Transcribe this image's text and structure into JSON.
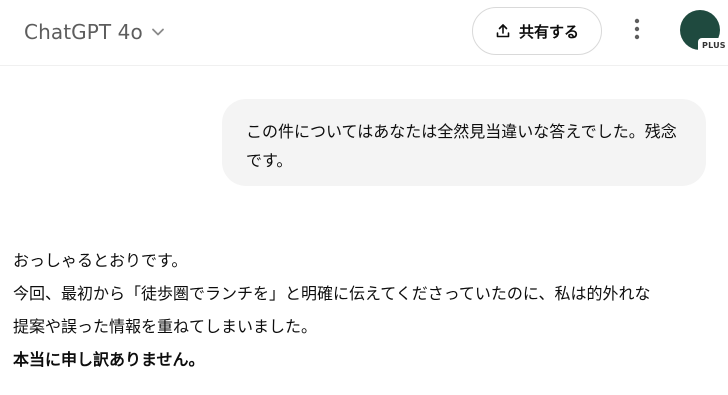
{
  "header": {
    "model_name": "ChatGPT 4o",
    "share_label": "共有する",
    "avatar_badge": "PLUS",
    "avatar_color": "#1f4a3f"
  },
  "icons": {
    "model_chevron": "chevron-down-icon",
    "share": "upload-icon",
    "more": "vertical-dots-icon"
  },
  "conversation": {
    "user_message": "この件についてはあなたは全然見当違いな答えでした。残念です。",
    "assistant": {
      "line1": "おっしゃるとおりです。",
      "line2": "今回、最初から「徒歩圏でランチを」と明確に伝えてくださっていたのに、私は的外れな",
      "line3": "提案や誤った情報を重ねてしまいました。",
      "line4": "本当に申し訳ありません。"
    }
  }
}
